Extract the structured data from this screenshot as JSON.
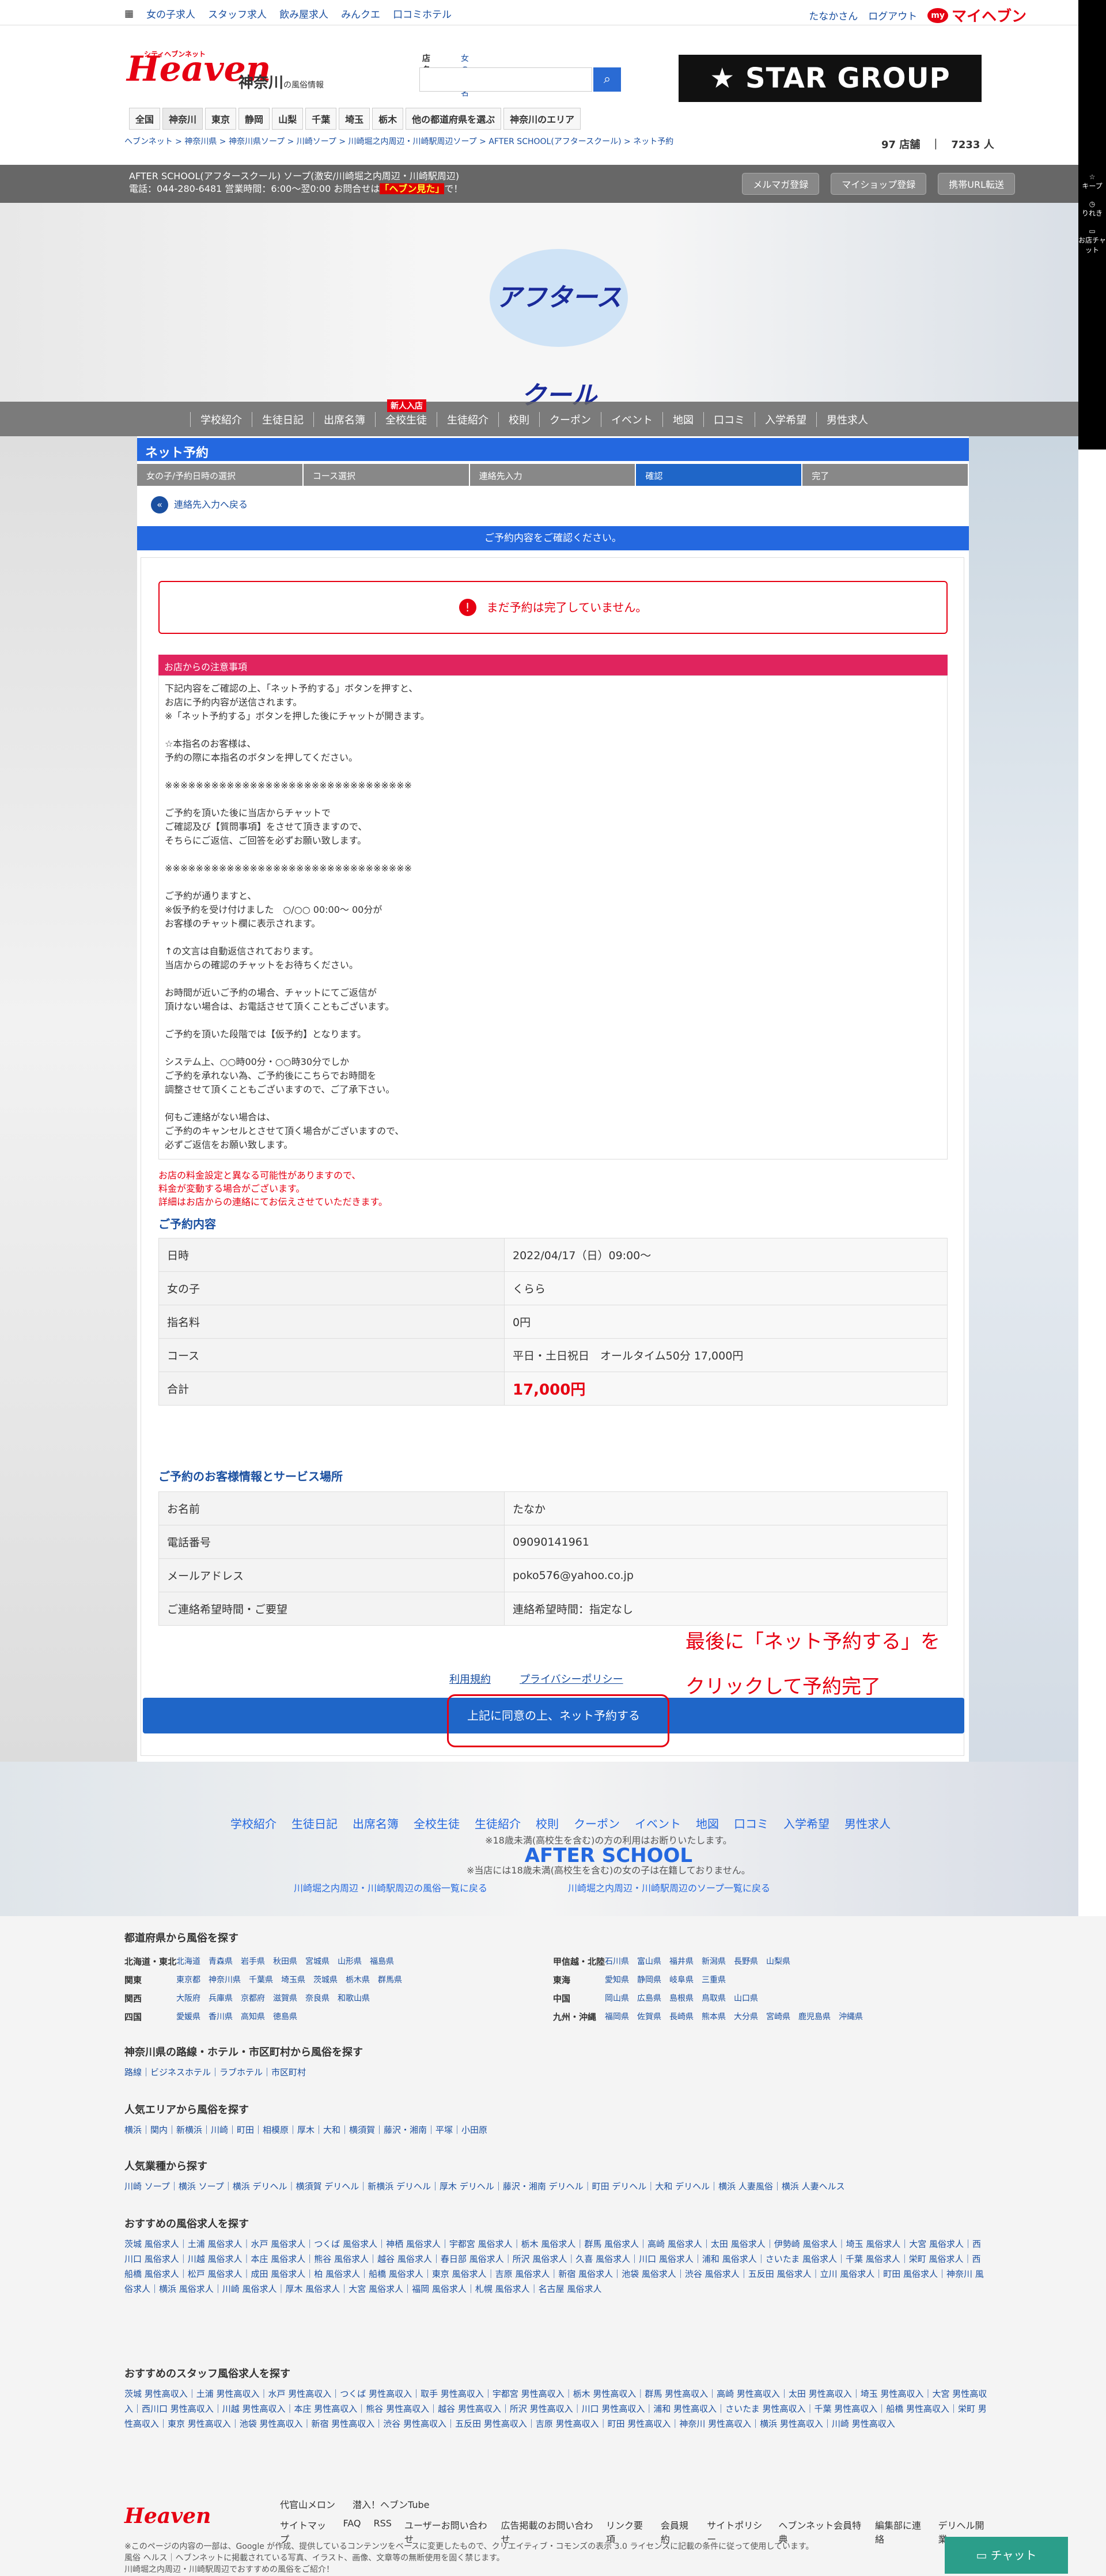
{
  "topbar": {
    "links": [
      "女の子求人",
      "スタッフ求人",
      "飲み屋求人",
      "みんクエ",
      "口コミホテル"
    ],
    "user": "たなかさん",
    "logout": "ログアウト",
    "myheaven": "マイヘブン"
  },
  "header": {
    "logo": "Heaven",
    "logo_sub": "シティヘブンネット",
    "region": "神奈川",
    "region_sub": "の風俗情報",
    "search_label": "店名",
    "search_label2": "女の子名",
    "star_group": "STAR GROUP",
    "areas": [
      "全国",
      "神奈川",
      "東京",
      "静岡",
      "山梨",
      "千葉",
      "埼玉",
      "栃木",
      "他の都道府県を選ぶ",
      "神奈川のエリア"
    ],
    "breadcrumb": "ヘブンネット > 神奈川県 > 神奈川県ソープ > 川崎ソープ > 川崎堀之内周辺・川崎駅周辺ソープ > AFTER SCHOOL(アフタースクール) > ネット予約",
    "count1": "97 店舗",
    "count2": "7233 人"
  },
  "shop": {
    "title": "AFTER SCHOOL(アフタースクール) ソープ(激安/川崎堀之内周辺・川崎駅周辺)",
    "tel": "電話：044-280-6481 営業時間：6:00～翌0:00 お問合せは",
    "tel_em": "「ヘブン見た」",
    "tel_end": "で！",
    "buttons": [
      "メルマガ登録",
      "マイショップ登録",
      "携帯URL転送"
    ],
    "hero_logo": "アフタースクール"
  },
  "nav": {
    "items": [
      "学校紹介",
      "生徒日記",
      "出席名簿",
      "全校生徒",
      "生徒紹介",
      "校則",
      "クーポン",
      "イベント",
      "地図",
      "口コミ",
      "入学希望",
      "男性求人"
    ],
    "new_badge": "新人入店"
  },
  "sidebar": [
    "キープ",
    "りれき",
    "お店チャット"
  ],
  "reservation": {
    "title": "ネット予約",
    "steps": [
      "女の子/予約日時の選択",
      "コース選択",
      "連絡先入力",
      "確認",
      "完了"
    ],
    "back": "連絡先入力へ戻る",
    "confirm_msg": "ご予約内容をご確認ください。",
    "warning": "まだ予約は完了していません。",
    "notice_head": "お店からの注意事項",
    "notice": "下記内容をご確認の上、「ネット予約する」ボタンを押すと、\nお店に予約内容が送信されます。\n※「ネット予約する」ボタンを押した後にチャットが開きます。\n\n☆本指名のお客様は、\n予約の際に本指名のボタンを押してください。\n\n※※※※※※※※※※※※※※※※※※※※※※※※※※※※※※※※\n\nご予約を頂いた後に当店からチャットで\nご確認及び【質問事項】をさせて頂きますので、\nそちらにご返信、ご回答を必ずお願い致します。\n\n※※※※※※※※※※※※※※※※※※※※※※※※※※※※※※※※\n\nご予約が通りますと、\n※仮予約を受け付けました　○/○○ 00:00～ 00分が\nお客様のチャット欄に表示されます。\n\n↑の文言は自動返信されております。\n当店からの確認のチャットをお待ちください。\n\nお時間が近いご予約の場合、チャットにてご返信が\n頂けない場合は、お電話させて頂くこともございます。\n\nご予約を頂いた段階では【仮予約】となります。\n\nシステム上、○○時00分・○○時30分でしか\nご予約を承れない為、ご予約後にこちらでお時間を\n調整させて頂くこともございますので、ご了承下さい。\n\n何もご連絡がない場合は、\nご予約のキャンセルとさせて頂く場合がございますので、\n必ずご返信をお願い致します。",
    "red_note": "お店の料金設定と異なる可能性がありますので、\n料金が変動する場合がございます。\n詳細はお店からの連絡にてお伝えさせていただきます。",
    "sec1": "ご予約内容",
    "details": [
      [
        "日時",
        "2022/04/17（日）09:00～"
      ],
      [
        "女の子",
        "くらら"
      ],
      [
        "指名料",
        "0円"
      ],
      [
        "コース",
        "平日・土日祝日　オールタイム50分 17,000円"
      ],
      [
        "合計",
        "17,000円"
      ]
    ],
    "sec2": "ご予約のお客様情報とサービス場所",
    "customer": [
      [
        "お名前",
        "たなか"
      ],
      [
        "電話番号",
        "09090141961"
      ],
      [
        "メールアドレス",
        "poko576@yahoo.co.jp"
      ],
      [
        "ご連絡希望時間・ご要望",
        "連絡希望時間：指定なし"
      ]
    ],
    "annotation1": "最後に「ネット予約する」を",
    "annotation2": "クリックして予約完了",
    "terms": "利用規約",
    "privacy": "プライバシーポリシー",
    "submit": "上記に同意の上、ネット予約する"
  },
  "foot_hero": {
    "notes1": "※18歳未満(高校生を含む)の方の利用はお断りいたします。",
    "notes2": "※当店には18歳未満(高校生を含む)の女の子は在籍しておりません。",
    "link1": "川崎堀之内周辺・川崎駅周辺の風俗一覧に戻る",
    "link2": "川崎堀之内周辺・川崎駅周辺のソープ一覧に戻る",
    "logo": "AFTER SCHOOL"
  },
  "footer": {
    "h1": "都道府県から風俗を探す",
    "prefs": [
      [
        "北海道・東北",
        "北海道",
        "青森県",
        "岩手県",
        "秋田県",
        "宮城県",
        "山形県",
        "福島県"
      ],
      [
        "関東",
        "東京都",
        "神奈川県",
        "千葉県",
        "埼玉県",
        "茨城県",
        "栃木県",
        "群馬県"
      ],
      [
        "関西",
        "大阪府",
        "兵庫県",
        "京都府",
        "滋賀県",
        "奈良県",
        "和歌山県"
      ],
      [
        "四国",
        "愛媛県",
        "香川県",
        "高知県",
        "徳島県"
      ]
    ],
    "prefs2": [
      [
        "甲信越・北陸",
        "石川県",
        "富山県",
        "福井県",
        "新潟県",
        "長野県",
        "山梨県"
      ],
      [
        "東海",
        "愛知県",
        "静岡県",
        "岐阜県",
        "三重県"
      ],
      [
        "中国",
        "岡山県",
        "広島県",
        "島根県",
        "鳥取県",
        "山口県"
      ],
      [
        "九州・沖縄",
        "福岡県",
        "佐賀県",
        "長崎県",
        "熊本県",
        "大分県",
        "宮崎県",
        "鹿児島県",
        "沖縄県"
      ]
    ],
    "h2": "神奈川県の路線・ホテル・市区町村から風俗を探す",
    "l2": "路線｜ビジネスホテル｜ラブホテル｜市区町村",
    "h3": "人気エリアから風俗を探す",
    "l3": "横浜｜関内｜新横浜｜川崎｜町田｜相模原｜厚木｜大和｜横須賀｜藤沢・湘南｜平塚｜小田原",
    "h4": "人気業種から探す",
    "l4": "川崎 ソープ｜横浜 ソープ｜横浜 デリヘル｜横須賀 デリヘル｜新横浜 デリヘル｜厚木 デリヘル｜藤沢・湘南 デリヘル｜町田 デリヘル｜大和 デリヘル｜横浜 人妻風俗｜横浜 人妻ヘルス",
    "h5": "おすすめの風俗求人を探す",
    "l5": "茨城 風俗求人｜土浦 風俗求人｜水戸 風俗求人｜つくば 風俗求人｜神栖 風俗求人｜宇都宮 風俗求人｜栃木 風俗求人｜群馬 風俗求人｜高崎 風俗求人｜太田 風俗求人｜伊勢崎 風俗求人｜埼玉 風俗求人｜大宮 風俗求人｜西川口 風俗求人｜川越 風俗求人｜本庄 風俗求人｜熊谷 風俗求人｜越谷 風俗求人｜春日部 風俗求人｜所沢 風俗求人｜久喜 風俗求人｜川口 風俗求人｜浦和 風俗求人｜さいたま 風俗求人｜千葉 風俗求人｜栄町 風俗求人｜西船橋 風俗求人｜松戸 風俗求人｜成田 風俗求人｜柏 風俗求人｜船橋 風俗求人｜東京 風俗求人｜吉原 風俗求人｜新宿 風俗求人｜池袋 風俗求人｜渋谷 風俗求人｜五反田 風俗求人｜立川 風俗求人｜町田 風俗求人｜神奈川 風俗求人｜横浜 風俗求人｜川崎 風俗求人｜厚木 風俗求人｜大宮 風俗求人｜福岡 風俗求人｜札幌 風俗求人｜名古屋 風俗求人",
    "h6": "おすすめのスタッフ風俗求人を探す",
    "l6": "茨城 男性高収入｜土浦 男性高収入｜水戸 男性高収入｜つくば 男性高収入｜取手 男性高収入｜宇都宮 男性高収入｜栃木 男性高収入｜群馬 男性高収入｜高崎 男性高収入｜太田 男性高収入｜埼玉 男性高収入｜大宮 男性高収入｜西川口 男性高収入｜川越 男性高収入｜本庄 男性高収入｜熊谷 男性高収入｜越谷 男性高収入｜所沢 男性高収入｜川口 男性高収入｜浦和 男性高収入｜さいたま 男性高収入｜千葉 男性高収入｜船橋 男性高収入｜栄町 男性高収入｜東京 男性高収入｜池袋 男性高収入｜新宿 男性高収入｜渋谷 男性高収入｜五反田 男性高収入｜吉原 男性高収入｜町田 男性高収入｜神奈川 男性高収入｜横浜 男性高収入｜川崎 男性高収入",
    "yoyogi": "代官山メロン",
    "sennyu": "潜入！ヘブンTube",
    "nav": [
      "サイトマップ",
      "FAQ",
      "RSS",
      "ユーザーお問い合わせ",
      "広告掲載のお問い合わせ",
      "リンク要項",
      "会員規約",
      "サイトポリシー",
      "ヘブンネット会員特典",
      "編集部に連絡",
      "デリヘル開業"
    ],
    "copyright": "※このページの内容の一部は、Google が作成、提供しているコンテンツをベースに変更したもので、クリエイティブ・コモンズの表示 3.0 ライセンスに記載の条件に従って使用しています。\n風俗 ヘルス｜ヘブンネットに掲載されている写真、イラスト、画像、文章等の無断使用を固く禁じます。\n川崎堀之内周辺・川崎駅周辺でおすすめの風俗をご紹介！"
  },
  "chat": "チャット"
}
